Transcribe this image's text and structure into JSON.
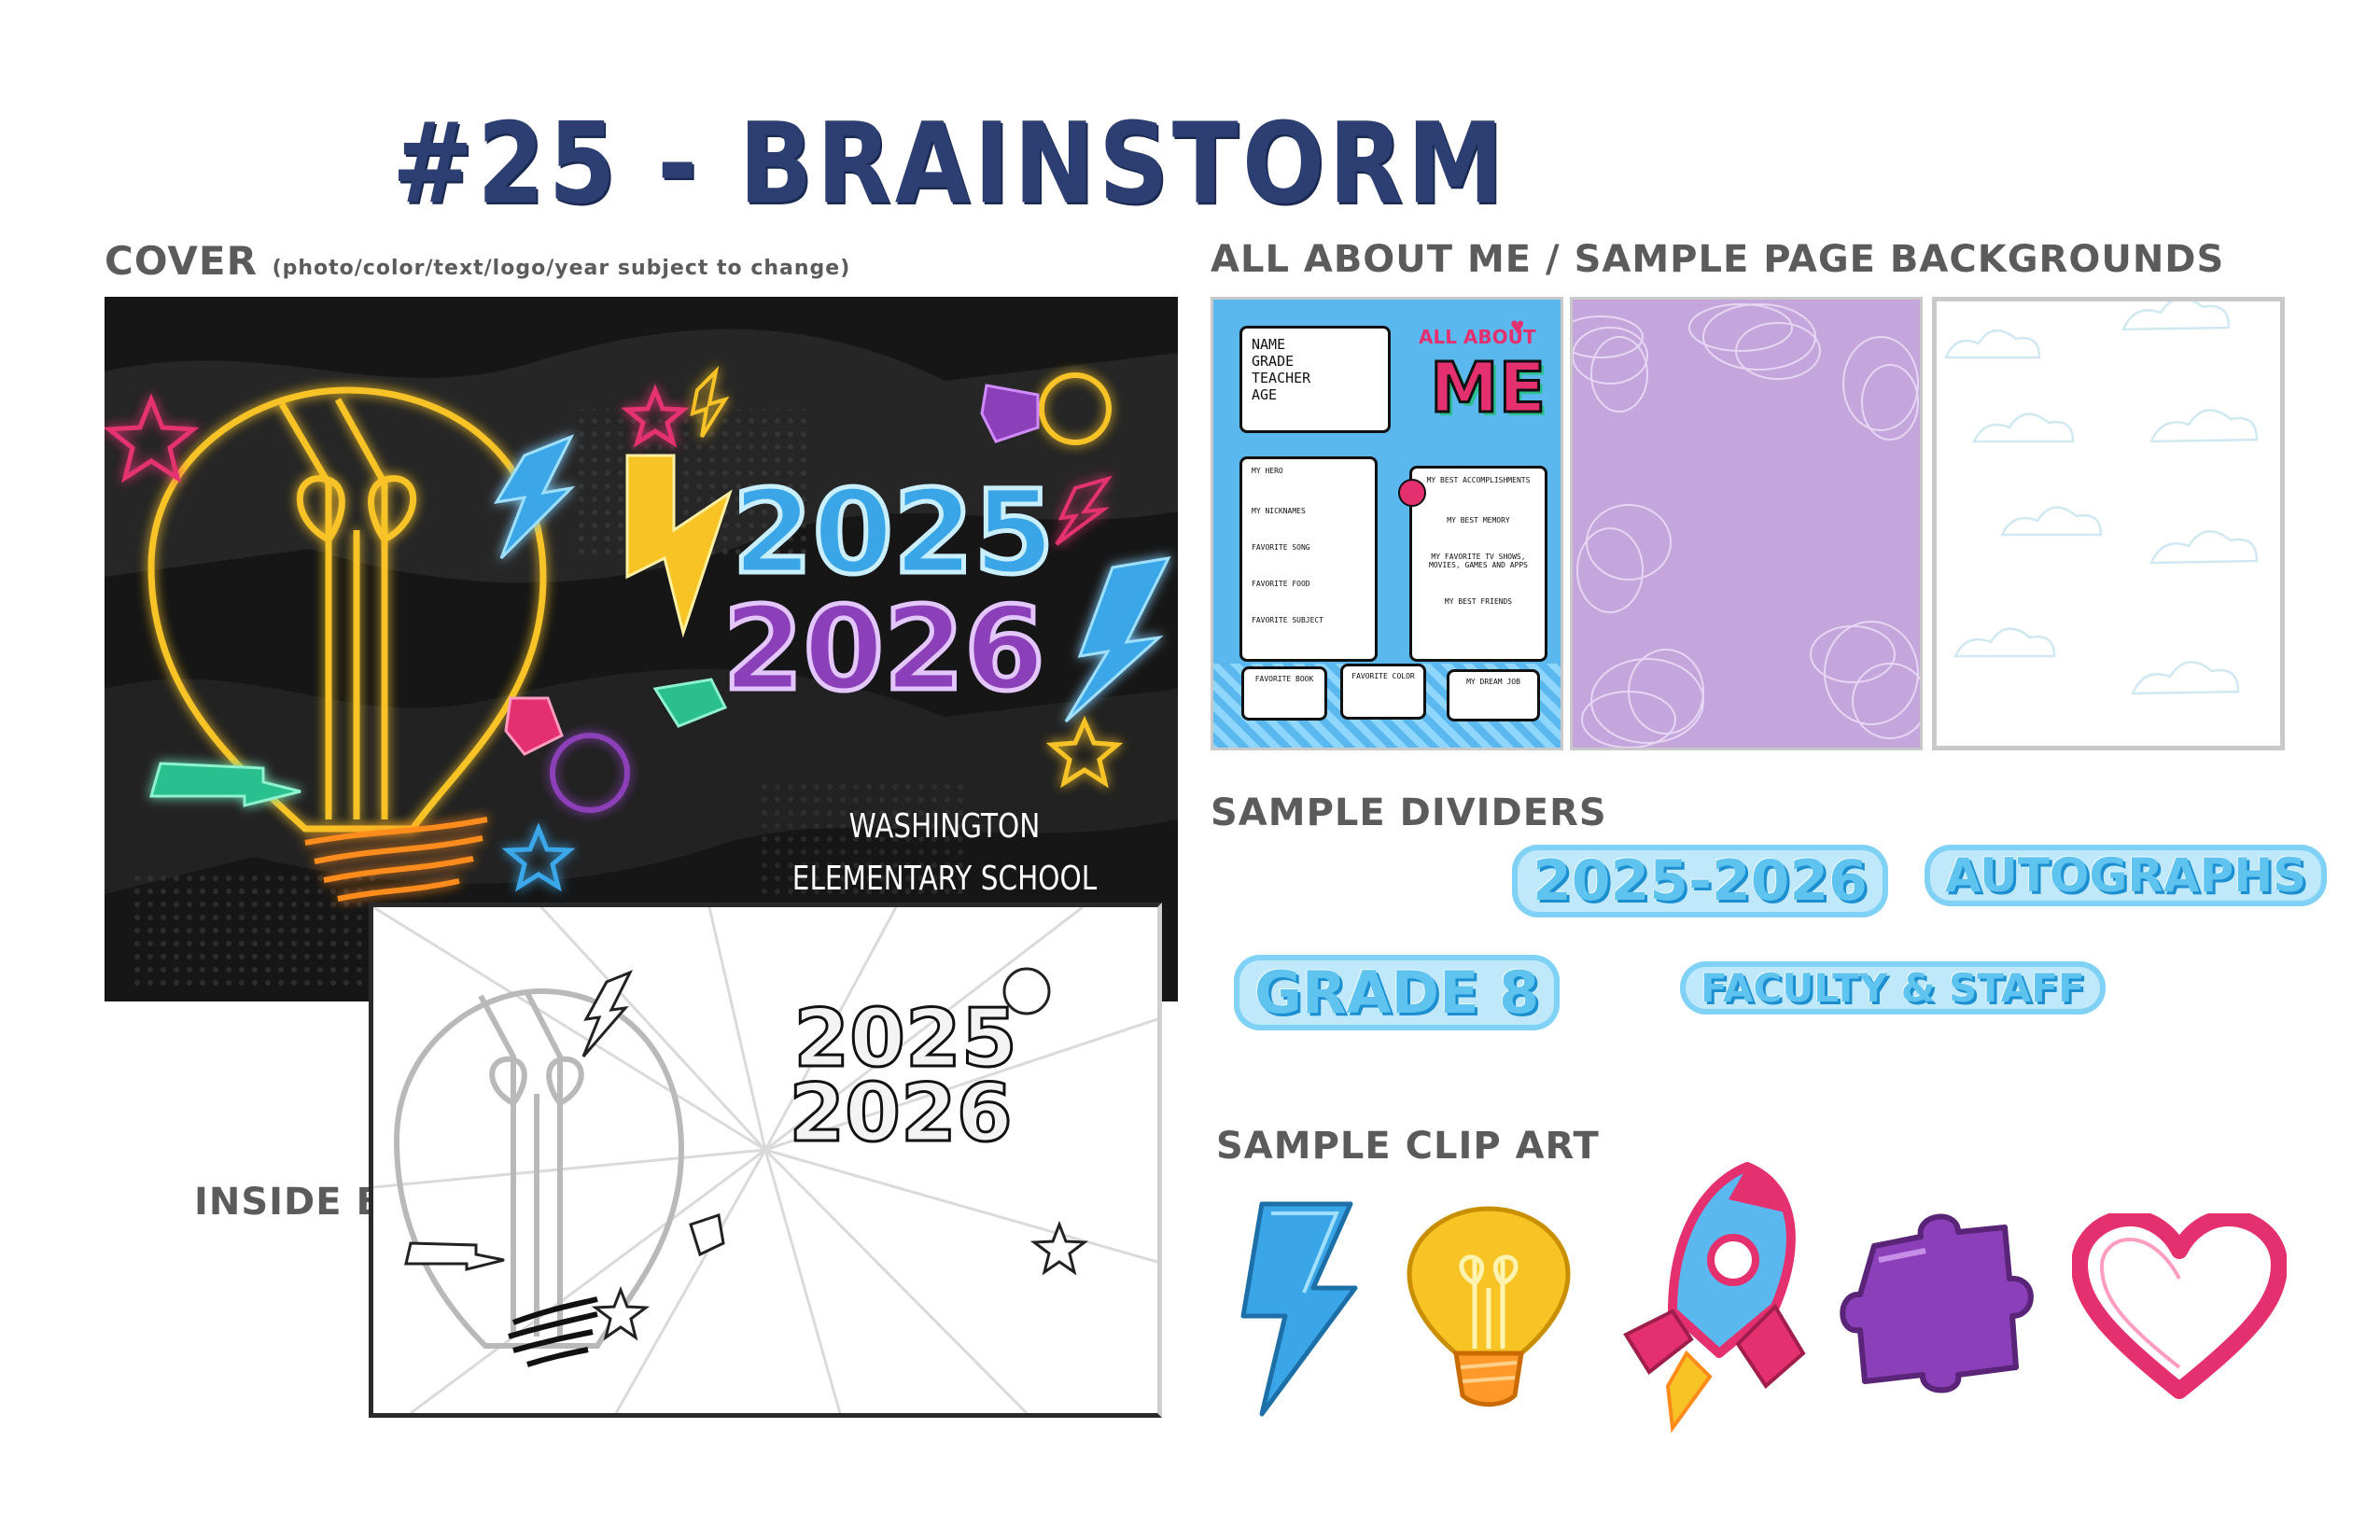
{
  "title": "#25 - BRAINSTORM",
  "sections": {
    "cover": "COVER",
    "cover_note": "(photo/color/text/logo/year subject to change)",
    "inserts": "ALL ABOUT ME / SAMPLE PAGE BACKGROUNDS",
    "tabs": "SAMPLE DIVIDERS",
    "clipart": "SAMPLE CLIP ART",
    "inside": "INSIDE BW"
  },
  "cover": {
    "year_top": "2025",
    "year_bottom": "2026",
    "school_line1": "WASHINGTON",
    "school_line2": "ELEMENTARY SCHOOL"
  },
  "all_about_me": {
    "heading_all": "ALL ABOUT",
    "heading_me": "ME",
    "fields": [
      "NAME",
      "GRADE",
      "TEACHER",
      "AGE"
    ],
    "left_box": [
      "MY HERO",
      "MY NICKNAMES",
      "FAVORITE SONG",
      "FAVORITE FOOD",
      "FAVORITE SUBJECT"
    ],
    "right_box": [
      "MY BEST ACCOMPLISHMENTS",
      "MY BEST MEMORY",
      "MY FAVORITE TV SHOWS, MOVIES, GAMES AND APPS",
      "MY BEST FRIENDS"
    ],
    "bottom": [
      "FAVORITE BOOK",
      "FAVORITE COLOR",
      "MY DREAM JOB"
    ]
  },
  "dividers": [
    "2025-2026",
    "AUTOGRAPHS",
    "GRADE 8",
    "FACULTY & STAFF"
  ],
  "clipart": [
    "lightning-bolt",
    "light-bulb",
    "rocket",
    "puzzle-piece",
    "heart"
  ],
  "colors": {
    "title": "#2c3e72",
    "label": "#5b5b5b",
    "neon_yellow": "#f7c325",
    "neon_blue": "#3aa6e8",
    "neon_purple": "#8b3fb8",
    "neon_pink": "#e5306f",
    "neon_green": "#2bbf8e",
    "lilac": "#c4a6dc",
    "tab_blue": "#5fc3ef"
  }
}
